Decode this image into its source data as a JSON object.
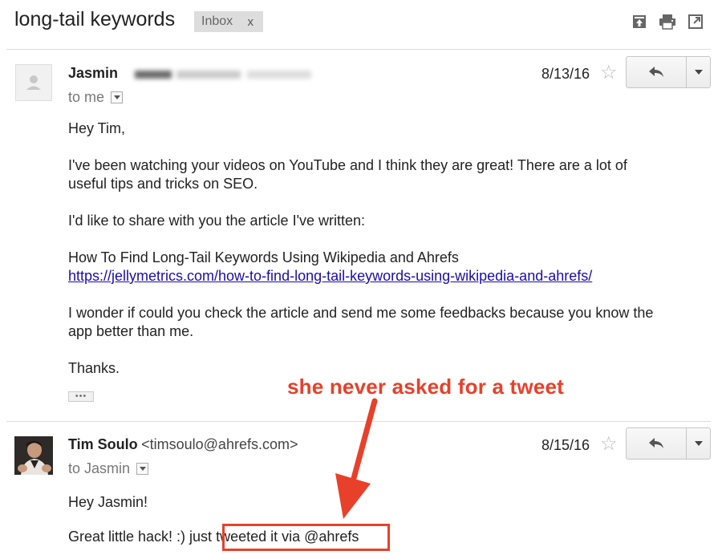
{
  "thread": {
    "subject": "long-tail keywords",
    "label": "Inbox",
    "label_remove": "x",
    "toolbar_icons": [
      "archive-icon",
      "print-icon",
      "new-window-icon"
    ]
  },
  "messages": [
    {
      "sender_name": "Jasmin",
      "sender_email_redacted": true,
      "to": "to me",
      "date": "8/13/16",
      "greeting": "Hey Tim,",
      "paragraphs": [
        [
          "I've been watching your videos on YouTube and I think they are great! There are a lot of",
          "useful tips and tricks on SEO."
        ],
        [
          "I'd like to share with you the article I've written:"
        ],
        [
          "How To Find Long-Tail Keywords Using Wikipedia and Ahrefs"
        ]
      ],
      "link": "https://jellymetrics.com/how-to-find-long-tail-keywords-using-wikipedia-and-ahrefs/",
      "paragraph_after_link": [
        "I wonder if could you check the article and send me some feedbacks because you know the",
        "app better than me."
      ],
      "closing": "Thanks.",
      "trimmed_content": "•••"
    },
    {
      "sender_name": "Tim Soulo",
      "sender_email": "<timsoulo@ahrefs.com>",
      "to": "to Jasmin",
      "date": "8/15/16",
      "greeting": "Hey Jasmin!",
      "line_prefix": "Great little hack! :) just",
      "line_highlight": "tweeted it via @ahrefs"
    }
  ],
  "annotation": {
    "text": "she never asked for a tweet",
    "color": "#e8402a"
  },
  "colors": {
    "link": "#1a0dab",
    "label_bg": "#dddddd",
    "divider": "#dddddd"
  }
}
